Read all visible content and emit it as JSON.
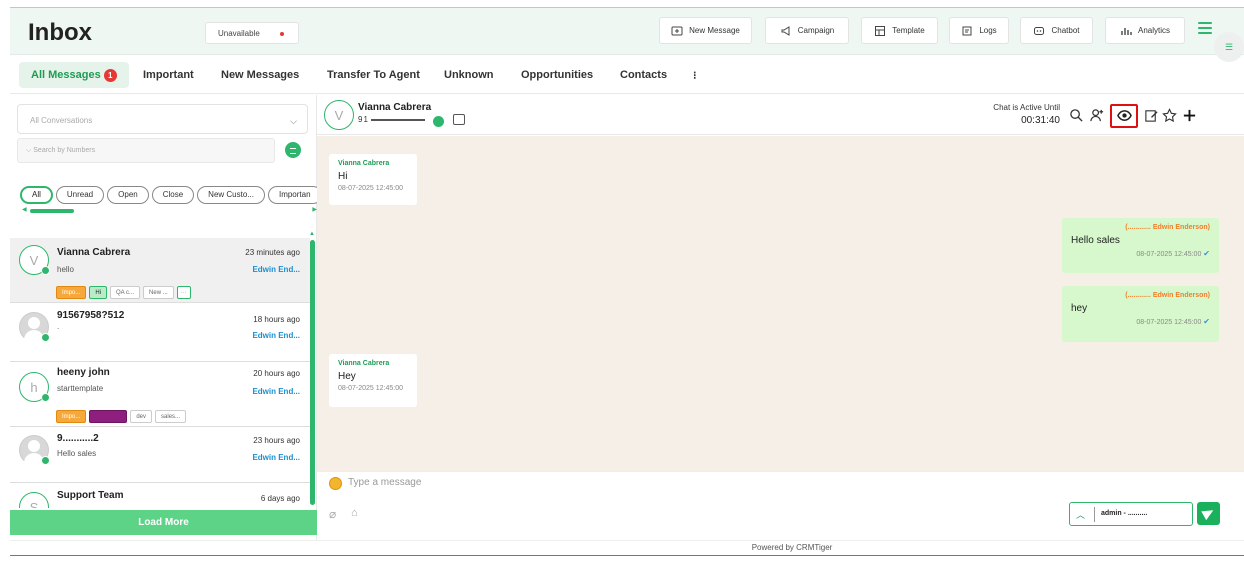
{
  "header": {
    "title": "Inbox",
    "status": "Unavailable",
    "buttons": [
      "New Message",
      "Campaign",
      "Template",
      "Logs",
      "Chatbot",
      "Analytics"
    ]
  },
  "tabs": [
    {
      "label": "All Messages",
      "badge": "1"
    },
    {
      "label": "Important"
    },
    {
      "label": "New Messages"
    },
    {
      "label": "Transfer To Agent"
    },
    {
      "label": "Unknown"
    },
    {
      "label": "Opportunities"
    },
    {
      "label": "Contacts"
    },
    {
      "label": "⁝"
    }
  ],
  "sidebar": {
    "conversation_filter": "All Conversations",
    "search_placeholder": "Search by Numbers",
    "pills": [
      "All",
      "Unread",
      "Open",
      "Close",
      "New Custo...",
      "Importan"
    ],
    "conversations": [
      {
        "initial": "V",
        "name": "Vianna Cabrera",
        "preview": "hello",
        "time": "23 minutes ago",
        "agent": "Edwin End...",
        "tags": [
          "Impo...",
          "Hi",
          "QA c...",
          "New ..."
        ]
      },
      {
        "initial": "",
        "name": "91567958?512",
        "preview": ".",
        "time": "18 hours ago",
        "agent": "Edwin End...",
        "tags": []
      },
      {
        "initial": "h",
        "name": "heeny john",
        "preview": "starttemplate",
        "time": "20 hours ago",
        "agent": "Edwin End...",
        "tags": [
          "Impo...",
          "",
          "dev",
          "sales..."
        ]
      },
      {
        "initial": "",
        "name": "9...........2",
        "preview": "Hello sales",
        "time": "23 hours ago",
        "agent": "Edwin End...",
        "tags": []
      },
      {
        "initial": "S",
        "name": "Support Team",
        "preview": "",
        "time": "6 days ago",
        "agent": "",
        "tags": []
      }
    ],
    "load_more": "Load More"
  },
  "chat": {
    "contact_initial": "V",
    "contact_name": "Vianna Cabrera",
    "contact_phone": "91",
    "active_label": "Chat is Active Until",
    "active_time": "00:31:40",
    "messages": [
      {
        "dir": "in",
        "sender": "Vianna Cabrera",
        "text": "Hi",
        "time": "08-07-2025 12:45:00"
      },
      {
        "dir": "out",
        "sender": "(............ Edwin Enderson)",
        "text": "Hello sales",
        "time": "08-07-2025 12:45:00"
      },
      {
        "dir": "out",
        "sender": "(............ Edwin Enderson)",
        "text": "hey",
        "time": "08-07-2025 12:45:00"
      },
      {
        "dir": "in",
        "sender": "Vianna Cabrera",
        "text": "Hey",
        "time": "08-07-2025 12:45:00"
      }
    ],
    "composer_placeholder": "Type a message",
    "agent_select": "admin - ..........",
    "footer": "Powered by CRMTiger"
  },
  "colors": {
    "accent": "#2eb66d",
    "badge": "#e53935",
    "highlight_box": "#dd1111"
  }
}
